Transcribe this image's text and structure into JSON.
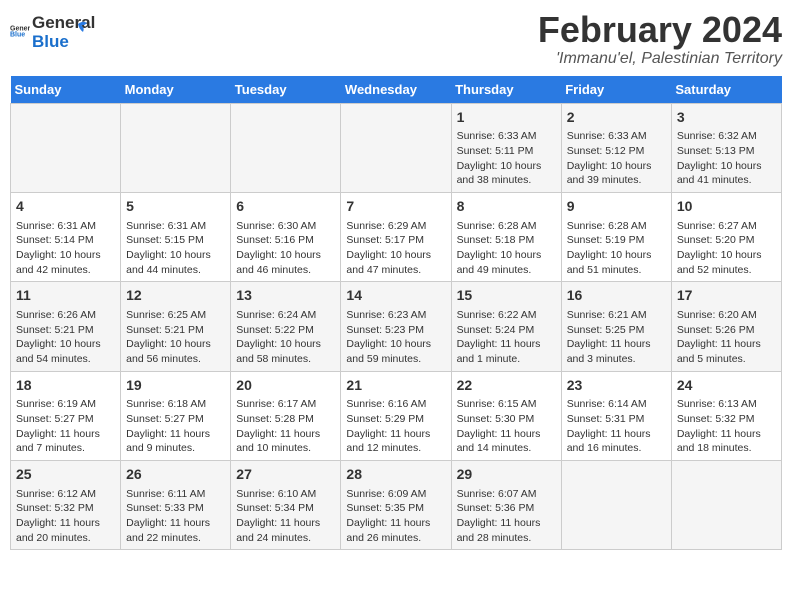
{
  "header": {
    "logo_line1": "General",
    "logo_line2": "Blue",
    "month": "February 2024",
    "location": "'Immanu'el, Palestinian Territory"
  },
  "days_of_week": [
    "Sunday",
    "Monday",
    "Tuesday",
    "Wednesday",
    "Thursday",
    "Friday",
    "Saturday"
  ],
  "weeks": [
    [
      {
        "day": "",
        "info": ""
      },
      {
        "day": "",
        "info": ""
      },
      {
        "day": "",
        "info": ""
      },
      {
        "day": "",
        "info": ""
      },
      {
        "day": "1",
        "info": "Sunrise: 6:33 AM\nSunset: 5:11 PM\nDaylight: 10 hours and 38 minutes."
      },
      {
        "day": "2",
        "info": "Sunrise: 6:33 AM\nSunset: 5:12 PM\nDaylight: 10 hours and 39 minutes."
      },
      {
        "day": "3",
        "info": "Sunrise: 6:32 AM\nSunset: 5:13 PM\nDaylight: 10 hours and 41 minutes."
      }
    ],
    [
      {
        "day": "4",
        "info": "Sunrise: 6:31 AM\nSunset: 5:14 PM\nDaylight: 10 hours and 42 minutes."
      },
      {
        "day": "5",
        "info": "Sunrise: 6:31 AM\nSunset: 5:15 PM\nDaylight: 10 hours and 44 minutes."
      },
      {
        "day": "6",
        "info": "Sunrise: 6:30 AM\nSunset: 5:16 PM\nDaylight: 10 hours and 46 minutes."
      },
      {
        "day": "7",
        "info": "Sunrise: 6:29 AM\nSunset: 5:17 PM\nDaylight: 10 hours and 47 minutes."
      },
      {
        "day": "8",
        "info": "Sunrise: 6:28 AM\nSunset: 5:18 PM\nDaylight: 10 hours and 49 minutes."
      },
      {
        "day": "9",
        "info": "Sunrise: 6:28 AM\nSunset: 5:19 PM\nDaylight: 10 hours and 51 minutes."
      },
      {
        "day": "10",
        "info": "Sunrise: 6:27 AM\nSunset: 5:20 PM\nDaylight: 10 hours and 52 minutes."
      }
    ],
    [
      {
        "day": "11",
        "info": "Sunrise: 6:26 AM\nSunset: 5:21 PM\nDaylight: 10 hours and 54 minutes."
      },
      {
        "day": "12",
        "info": "Sunrise: 6:25 AM\nSunset: 5:21 PM\nDaylight: 10 hours and 56 minutes."
      },
      {
        "day": "13",
        "info": "Sunrise: 6:24 AM\nSunset: 5:22 PM\nDaylight: 10 hours and 58 minutes."
      },
      {
        "day": "14",
        "info": "Sunrise: 6:23 AM\nSunset: 5:23 PM\nDaylight: 10 hours and 59 minutes."
      },
      {
        "day": "15",
        "info": "Sunrise: 6:22 AM\nSunset: 5:24 PM\nDaylight: 11 hours and 1 minute."
      },
      {
        "day": "16",
        "info": "Sunrise: 6:21 AM\nSunset: 5:25 PM\nDaylight: 11 hours and 3 minutes."
      },
      {
        "day": "17",
        "info": "Sunrise: 6:20 AM\nSunset: 5:26 PM\nDaylight: 11 hours and 5 minutes."
      }
    ],
    [
      {
        "day": "18",
        "info": "Sunrise: 6:19 AM\nSunset: 5:27 PM\nDaylight: 11 hours and 7 minutes."
      },
      {
        "day": "19",
        "info": "Sunrise: 6:18 AM\nSunset: 5:27 PM\nDaylight: 11 hours and 9 minutes."
      },
      {
        "day": "20",
        "info": "Sunrise: 6:17 AM\nSunset: 5:28 PM\nDaylight: 11 hours and 10 minutes."
      },
      {
        "day": "21",
        "info": "Sunrise: 6:16 AM\nSunset: 5:29 PM\nDaylight: 11 hours and 12 minutes."
      },
      {
        "day": "22",
        "info": "Sunrise: 6:15 AM\nSunset: 5:30 PM\nDaylight: 11 hours and 14 minutes."
      },
      {
        "day": "23",
        "info": "Sunrise: 6:14 AM\nSunset: 5:31 PM\nDaylight: 11 hours and 16 minutes."
      },
      {
        "day": "24",
        "info": "Sunrise: 6:13 AM\nSunset: 5:32 PM\nDaylight: 11 hours and 18 minutes."
      }
    ],
    [
      {
        "day": "25",
        "info": "Sunrise: 6:12 AM\nSunset: 5:32 PM\nDaylight: 11 hours and 20 minutes."
      },
      {
        "day": "26",
        "info": "Sunrise: 6:11 AM\nSunset: 5:33 PM\nDaylight: 11 hours and 22 minutes."
      },
      {
        "day": "27",
        "info": "Sunrise: 6:10 AM\nSunset: 5:34 PM\nDaylight: 11 hours and 24 minutes."
      },
      {
        "day": "28",
        "info": "Sunrise: 6:09 AM\nSunset: 5:35 PM\nDaylight: 11 hours and 26 minutes."
      },
      {
        "day": "29",
        "info": "Sunrise: 6:07 AM\nSunset: 5:36 PM\nDaylight: 11 hours and 28 minutes."
      },
      {
        "day": "",
        "info": ""
      },
      {
        "day": "",
        "info": ""
      }
    ]
  ]
}
